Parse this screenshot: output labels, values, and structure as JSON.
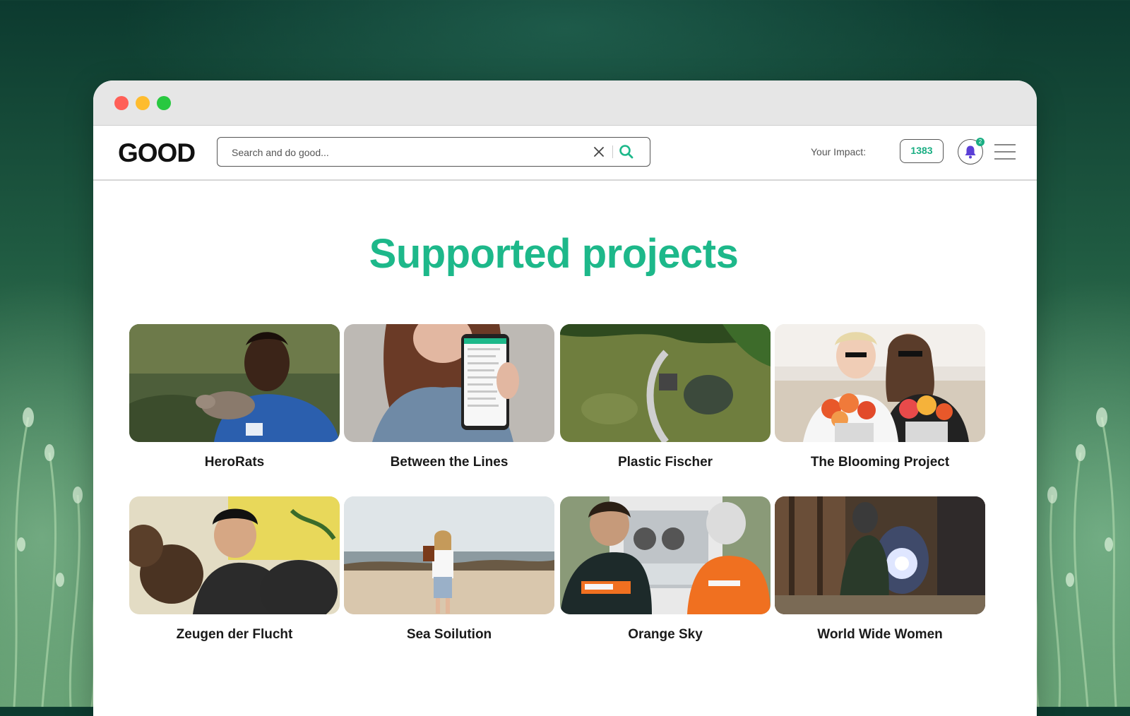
{
  "header": {
    "logo": "GOOD",
    "search_placeholder": "Search and do good...",
    "impact_label": "Your Impact:",
    "impact_value": "1383",
    "notification_count": "2"
  },
  "main": {
    "title": "Supported projects",
    "projects": [
      {
        "name": "HeroRats"
      },
      {
        "name": "Between the Lines"
      },
      {
        "name": "Plastic Fischer"
      },
      {
        "name": "The Blooming Project"
      },
      {
        "name": "Zeugen der Flucht"
      },
      {
        "name": "Sea Soilution"
      },
      {
        "name": "Orange Sky"
      },
      {
        "name": "World Wide Women"
      }
    ]
  },
  "colors": {
    "accent": "#1db88a",
    "notification_bell": "#5b3fd6"
  }
}
